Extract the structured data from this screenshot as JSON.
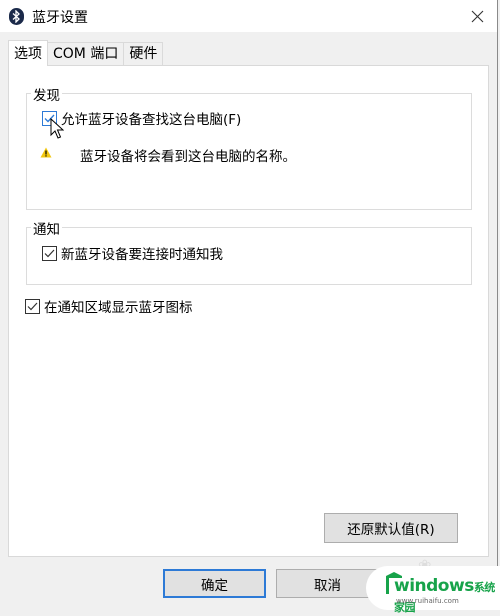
{
  "window": {
    "title": "蓝牙设置",
    "icon": "bluetooth-icon",
    "close_icon": "close-icon"
  },
  "tabs": [
    {
      "label": "选项",
      "active": true
    },
    {
      "label": "COM 端口",
      "active": false
    },
    {
      "label": "硬件",
      "active": false
    }
  ],
  "discovery": {
    "group_label": "发现",
    "allow_discovery": {
      "label": "允许蓝牙设备查找这台电脑(F)",
      "checked": true
    },
    "warning_icon": "warning-icon",
    "warning_text": "蓝牙设备将会看到这台电脑的名称。"
  },
  "notifications": {
    "group_label": "通知",
    "notify_new_device": {
      "label": "新蓝牙设备要连接时通知我",
      "checked": true
    }
  },
  "show_tray_icon": {
    "label": "在通知区域显示蓝牙图标",
    "checked": true
  },
  "buttons": {
    "restore_defaults": "还原默认值(R)",
    "ok": "确定",
    "cancel": "取消"
  },
  "watermark": {
    "brand": "windows",
    "brand_suffix": "系统家园",
    "url": "www.ruihaifu.com"
  },
  "colors": {
    "accent": "#2d7ad6",
    "warning": "#f2c811",
    "watermark_green": "#17a34a"
  }
}
